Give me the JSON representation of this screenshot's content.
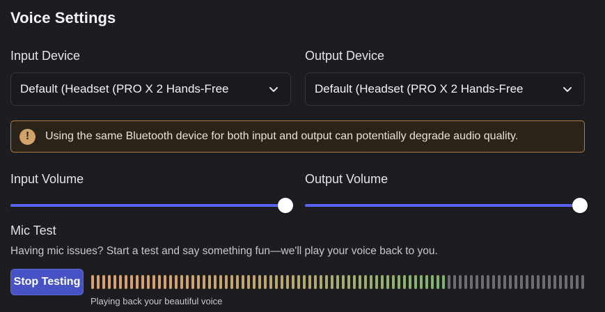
{
  "title": "Voice Settings",
  "input_device": {
    "label": "Input Device",
    "value": "Default (Headset (PRO X 2 Hands-Free"
  },
  "output_device": {
    "label": "Output Device",
    "value": "Default (Headset (PRO X 2 Hands-Free"
  },
  "warning": {
    "icon": "exclamation-circle-icon",
    "text": "Using the same Bluetooth device for both input and output can potentially degrade audio quality."
  },
  "input_volume": {
    "label": "Input Volume",
    "level": 1.0
  },
  "output_volume": {
    "label": "Output Volume",
    "level": 1.0
  },
  "mic_test": {
    "title": "Mic Test",
    "description": "Having mic issues? Start a test and say something fun—we'll play your voice back to you.",
    "button_label": "Stop Testing",
    "caption": "Playing back your beautiful voice",
    "meter_total_bars": 89,
    "meter_active_bars": 64
  },
  "colors": {
    "accent": "#5865f2",
    "button": "#4752c4",
    "warning_border": "#b77d3e",
    "warning_icon": "#d1a36a",
    "meter_low": "#d9a06a",
    "meter_high": "#7fb56a",
    "meter_idle": "#6b6c72"
  }
}
